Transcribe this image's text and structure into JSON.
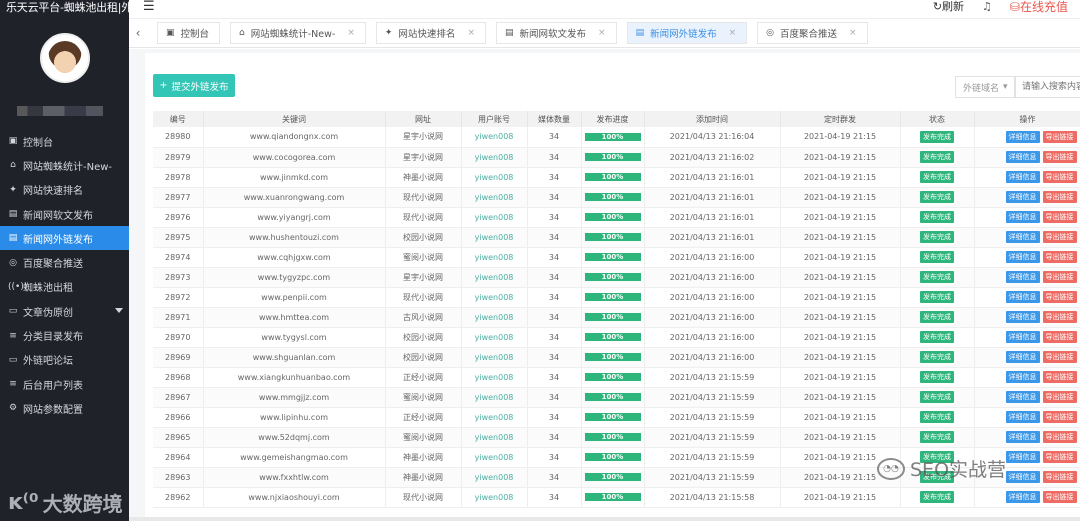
{
  "app": {
    "title": "乐天云平台-蜘蛛池出租|外"
  },
  "topbar": {
    "refresh": "刷新",
    "recharge": "在线充值"
  },
  "sidebar": {
    "items": [
      {
        "icon": "▣",
        "label": "控制台"
      },
      {
        "icon": "⌂",
        "label": "网站蜘蛛统计-New-"
      },
      {
        "icon": "✦",
        "label": "网站快速排名"
      },
      {
        "icon": "▤",
        "label": "新闻网软文发布"
      },
      {
        "icon": "▤",
        "label": "新闻网外链发布"
      },
      {
        "icon": "◎",
        "label": "百度聚合推送"
      },
      {
        "icon": "((•))",
        "label": "蜘蛛池出租"
      },
      {
        "icon": "▭",
        "label": "文章伪原创"
      },
      {
        "icon": "≡",
        "label": "分类目录发布"
      },
      {
        "icon": "▭",
        "label": "外链吧论坛"
      },
      {
        "icon": "≡",
        "label": "后台用户列表"
      },
      {
        "icon": "⚙",
        "label": "网站参数配置"
      }
    ],
    "brand": "大数跨境"
  },
  "tabs": [
    {
      "icon": "▣",
      "label": "控制台"
    },
    {
      "icon": "⌂",
      "label": "网站蜘蛛统计-New-"
    },
    {
      "icon": "✦",
      "label": "网站快速排名"
    },
    {
      "icon": "▤",
      "label": "新闻网软文发布"
    },
    {
      "icon": "▤",
      "label": "新闻网外链发布"
    },
    {
      "icon": "◎",
      "label": "百度聚合推送"
    }
  ],
  "toolbar": {
    "submit_label": "提交外链发布",
    "domain_select": "外链域名",
    "search_placeholder": "请输入搜索内容"
  },
  "table": {
    "headers": [
      "编号",
      "关键词",
      "网址",
      "用户账号",
      "媒体数量",
      "发布进度",
      "添加时间",
      "定时群发",
      "状态",
      "操作"
    ],
    "status_label": "发布完成",
    "detail_label": "详细信息",
    "export_label": "导出链接",
    "rows": [
      {
        "id": "28980",
        "keyword": "www.qiandongnx.com",
        "site": "星宇小说网",
        "user": "yiwen008",
        "media": "34",
        "progress": "100%",
        "added": "2021/04/13 21:16:04",
        "scheduled": "2021-04-19 21:15"
      },
      {
        "id": "28979",
        "keyword": "www.cocogorea.com",
        "site": "星宇小说网",
        "user": "yiwen008",
        "media": "34",
        "progress": "100%",
        "added": "2021/04/13 21:16:02",
        "scheduled": "2021-04-19 21:15"
      },
      {
        "id": "28978",
        "keyword": "www.jinmkd.com",
        "site": "神墨小说网",
        "user": "yiwen008",
        "media": "34",
        "progress": "100%",
        "added": "2021/04/13 21:16:01",
        "scheduled": "2021-04-19 21:15"
      },
      {
        "id": "28977",
        "keyword": "www.xuanrongwang.com",
        "site": "现代小说网",
        "user": "yiwen008",
        "media": "34",
        "progress": "100%",
        "added": "2021/04/13 21:16:01",
        "scheduled": "2021-04-19 21:15"
      },
      {
        "id": "28976",
        "keyword": "www.yiyangrj.com",
        "site": "现代小说网",
        "user": "yiwen008",
        "media": "34",
        "progress": "100%",
        "added": "2021/04/13 21:16:01",
        "scheduled": "2021-04-19 21:15"
      },
      {
        "id": "28975",
        "keyword": "www.hushentouzi.com",
        "site": "校园小说网",
        "user": "yiwen008",
        "media": "34",
        "progress": "100%",
        "added": "2021/04/13 21:16:01",
        "scheduled": "2021-04-19 21:15"
      },
      {
        "id": "28974",
        "keyword": "www.cqhjgxw.com",
        "site": "蜜阅小说网",
        "user": "yiwen008",
        "media": "34",
        "progress": "100%",
        "added": "2021/04/13 21:16:00",
        "scheduled": "2021-04-19 21:15"
      },
      {
        "id": "28973",
        "keyword": "www.tygyzpc.com",
        "site": "星宇小说网",
        "user": "yiwen008",
        "media": "34",
        "progress": "100%",
        "added": "2021/04/13 21:16:00",
        "scheduled": "2021-04-19 21:15"
      },
      {
        "id": "28972",
        "keyword": "www.penpii.com",
        "site": "现代小说网",
        "user": "yiwen008",
        "media": "34",
        "progress": "100%",
        "added": "2021/04/13 21:16:00",
        "scheduled": "2021-04-19 21:15"
      },
      {
        "id": "28971",
        "keyword": "www.hmttea.com",
        "site": "古风小说网",
        "user": "yiwen008",
        "media": "34",
        "progress": "100%",
        "added": "2021/04/13 21:16:00",
        "scheduled": "2021-04-19 21:15"
      },
      {
        "id": "28970",
        "keyword": "www.tygysl.com",
        "site": "校园小说网",
        "user": "yiwen008",
        "media": "34",
        "progress": "100%",
        "added": "2021/04/13 21:16:00",
        "scheduled": "2021-04-19 21:15"
      },
      {
        "id": "28969",
        "keyword": "www.shguanlan.com",
        "site": "校园小说网",
        "user": "yiwen008",
        "media": "34",
        "progress": "100%",
        "added": "2021/04/13 21:16:00",
        "scheduled": "2021-04-19 21:15"
      },
      {
        "id": "28968",
        "keyword": "www.xiangkunhuanbao.com",
        "site": "正经小说网",
        "user": "yiwen008",
        "media": "34",
        "progress": "100%",
        "added": "2021/04/13 21:15:59",
        "scheduled": "2021-04-19 21:15"
      },
      {
        "id": "28967",
        "keyword": "www.mmgjjz.com",
        "site": "蜜阅小说网",
        "user": "yiwen008",
        "media": "34",
        "progress": "100%",
        "added": "2021/04/13 21:15:59",
        "scheduled": "2021-04-19 21:15"
      },
      {
        "id": "28966",
        "keyword": "www.lipinhu.com",
        "site": "正经小说网",
        "user": "yiwen008",
        "media": "34",
        "progress": "100%",
        "added": "2021/04/13 21:15:59",
        "scheduled": "2021-04-19 21:15"
      },
      {
        "id": "28965",
        "keyword": "www.52dqmj.com",
        "site": "蜜阅小说网",
        "user": "yiwen008",
        "media": "34",
        "progress": "100%",
        "added": "2021/04/13 21:15:59",
        "scheduled": "2021-04-19 21:15"
      },
      {
        "id": "28964",
        "keyword": "www.gemeishangmao.com",
        "site": "神墨小说网",
        "user": "yiwen008",
        "media": "34",
        "progress": "100%",
        "added": "2021/04/13 21:15:59",
        "scheduled": "2021-04-19 21:15"
      },
      {
        "id": "28963",
        "keyword": "www.fxxhtlw.com",
        "site": "神墨小说网",
        "user": "yiwen008",
        "media": "34",
        "progress": "100%",
        "added": "2021/04/13 21:15:59",
        "scheduled": "2021-04-19 21:15"
      },
      {
        "id": "28962",
        "keyword": "www.njxiaoshouyi.com",
        "site": "现代小说网",
        "user": "yiwen008",
        "media": "34",
        "progress": "100%",
        "added": "2021/04/13 21:15:58",
        "scheduled": "2021-04-19 21:15"
      }
    ]
  },
  "watermark": "SEO实战营"
}
